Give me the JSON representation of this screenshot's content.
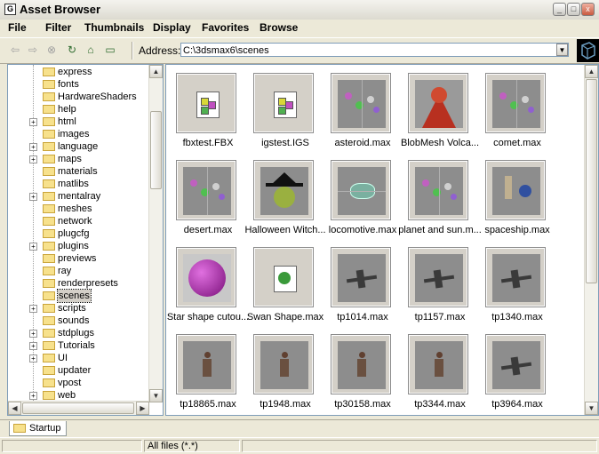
{
  "window": {
    "title": "Asset Browser",
    "app_icon": "G",
    "controls": [
      "_",
      "□",
      "x"
    ]
  },
  "menu": [
    "File",
    "Filter",
    "Thumbnails",
    "Display",
    "Favorites",
    "Browse"
  ],
  "toolbar": {
    "icons": [
      {
        "name": "back-arrow-icon",
        "glyph": "⇦",
        "active": false
      },
      {
        "name": "forward-arrow-icon",
        "glyph": "⇨",
        "active": false
      },
      {
        "name": "stop-icon",
        "glyph": "⊗",
        "active": false
      },
      {
        "name": "refresh-icon",
        "glyph": "↻",
        "active": true
      },
      {
        "name": "home-icon",
        "glyph": "⌂",
        "active": true
      },
      {
        "name": "folder-icon",
        "glyph": "▭",
        "active": true
      }
    ],
    "address_label": "Address:",
    "address_value": "C:\\3dsmax6\\scenes"
  },
  "tree": {
    "items": [
      {
        "label": "express",
        "expandable": false
      },
      {
        "label": "fonts",
        "expandable": false
      },
      {
        "label": "HardwareShaders",
        "expandable": false
      },
      {
        "label": "help",
        "expandable": false
      },
      {
        "label": "html",
        "expandable": true
      },
      {
        "label": "images",
        "expandable": false
      },
      {
        "label": "language",
        "expandable": true
      },
      {
        "label": "maps",
        "expandable": true
      },
      {
        "label": "materials",
        "expandable": false
      },
      {
        "label": "matlibs",
        "expandable": false
      },
      {
        "label": "mentalray",
        "expandable": true
      },
      {
        "label": "meshes",
        "expandable": false
      },
      {
        "label": "network",
        "expandable": false
      },
      {
        "label": "plugcfg",
        "expandable": false
      },
      {
        "label": "plugins",
        "expandable": true
      },
      {
        "label": "previews",
        "expandable": false
      },
      {
        "label": "ray",
        "expandable": false
      },
      {
        "label": "renderpresets",
        "expandable": false
      },
      {
        "label": "scenes",
        "expandable": false,
        "selected": true
      },
      {
        "label": "scripts",
        "expandable": true
      },
      {
        "label": "sounds",
        "expandable": false
      },
      {
        "label": "stdplugs",
        "expandable": true
      },
      {
        "label": "Tutorials",
        "expandable": true
      },
      {
        "label": "UI",
        "expandable": true
      },
      {
        "label": "updater",
        "expandable": false
      },
      {
        "label": "vpost",
        "expandable": false
      },
      {
        "label": "web",
        "expandable": true
      }
    ]
  },
  "thumbnails": [
    {
      "label": "fbxtest.FBX",
      "kind": "doc"
    },
    {
      "label": "igstest.IGS",
      "kind": "doc"
    },
    {
      "label": "asteroid.max",
      "kind": "scene-balls"
    },
    {
      "label": "BlobMesh Volca...",
      "kind": "volcano"
    },
    {
      "label": "comet.max",
      "kind": "scene-balls"
    },
    {
      "label": "desert.max",
      "kind": "scene-balls"
    },
    {
      "label": "Halloween Witch...",
      "kind": "witch"
    },
    {
      "label": "locomotive.max",
      "kind": "scene-loco"
    },
    {
      "label": "planet and sun.m...",
      "kind": "scene-balls"
    },
    {
      "label": "spaceship.max",
      "kind": "spaceship"
    },
    {
      "label": "Star shape cutou...",
      "kind": "star"
    },
    {
      "label": "Swan Shape.max",
      "kind": "doc-green"
    },
    {
      "label": "tp1014.max",
      "kind": "plane"
    },
    {
      "label": "tp1157.max",
      "kind": "plane"
    },
    {
      "label": "tp1340.max",
      "kind": "plane"
    },
    {
      "label": "tp18865.max",
      "kind": "figure"
    },
    {
      "label": "tp1948.max",
      "kind": "figure"
    },
    {
      "label": "tp30158.max",
      "kind": "figure"
    },
    {
      "label": "tp3344.max",
      "kind": "figure"
    },
    {
      "label": "tp3964.max",
      "kind": "plane"
    }
  ],
  "bottom_tab": "Startup",
  "status": {
    "left": "",
    "filter": "All files (*.*)",
    "right": ""
  },
  "colors": {
    "selection": "#d4d0c8",
    "thumb_bg": "#8d8d8d",
    "folder": "#f7e18c",
    "accent": "#316ac5"
  }
}
